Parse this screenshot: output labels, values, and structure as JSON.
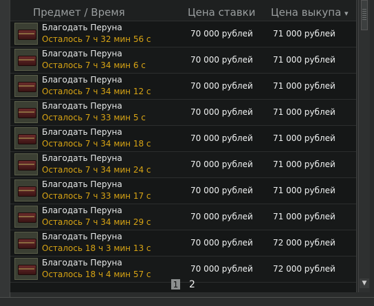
{
  "header": {
    "item_time": "Предмет   /   Время",
    "bid_price": "Цена ставки",
    "buyout_price": "Цена выкупа",
    "sort_arrow": "▾"
  },
  "rows": [
    {
      "name": "Благодать Перуна",
      "time": "Осталось 7 ч 32 мин 56 с",
      "bid": "70 000 рублей",
      "buy": "71 000 рублей"
    },
    {
      "name": "Благодать Перуна",
      "time": "Осталось 7 ч 34 мин 6 с",
      "bid": "70 000 рублей",
      "buy": "71 000 рублей"
    },
    {
      "name": "Благодать Перуна",
      "time": "Осталось 7 ч 34 мин 12 с",
      "bid": "70 000 рублей",
      "buy": "71 000 рублей"
    },
    {
      "name": "Благодать Перуна",
      "time": "Осталось 7 ч 33 мин 5 с",
      "bid": "70 000 рублей",
      "buy": "71 000 рублей"
    },
    {
      "name": "Благодать Перуна",
      "time": "Осталось 7 ч 34 мин 18 с",
      "bid": "70 000 рублей",
      "buy": "71 000 рублей"
    },
    {
      "name": "Благодать Перуна",
      "time": "Осталось 7 ч 34 мин 24 с",
      "bid": "70 000 рублей",
      "buy": "71 000 рублей"
    },
    {
      "name": "Благодать Перуна",
      "time": "Осталось 7 ч 33 мин 17 с",
      "bid": "70 000 рублей",
      "buy": "71 000 рублей"
    },
    {
      "name": "Благодать Перуна",
      "time": "Осталось 7 ч 34 мин 29 с",
      "bid": "70 000 рублей",
      "buy": "71 000 рублей"
    },
    {
      "name": "Благодать Перуна",
      "time": "Осталось 18 ч 3 мин 13 с",
      "bid": "70 000 рублей",
      "buy": "72 000 рублей"
    },
    {
      "name": "Благодать Перуна",
      "time": "Осталось 18 ч 4 мин 57 с",
      "bid": "70 000 рублей",
      "buy": "72 000 рублей"
    }
  ],
  "pagination": {
    "pages": [
      "1",
      "2"
    ],
    "current": "1"
  },
  "scrollbar": {
    "down_arrow": "▼"
  }
}
